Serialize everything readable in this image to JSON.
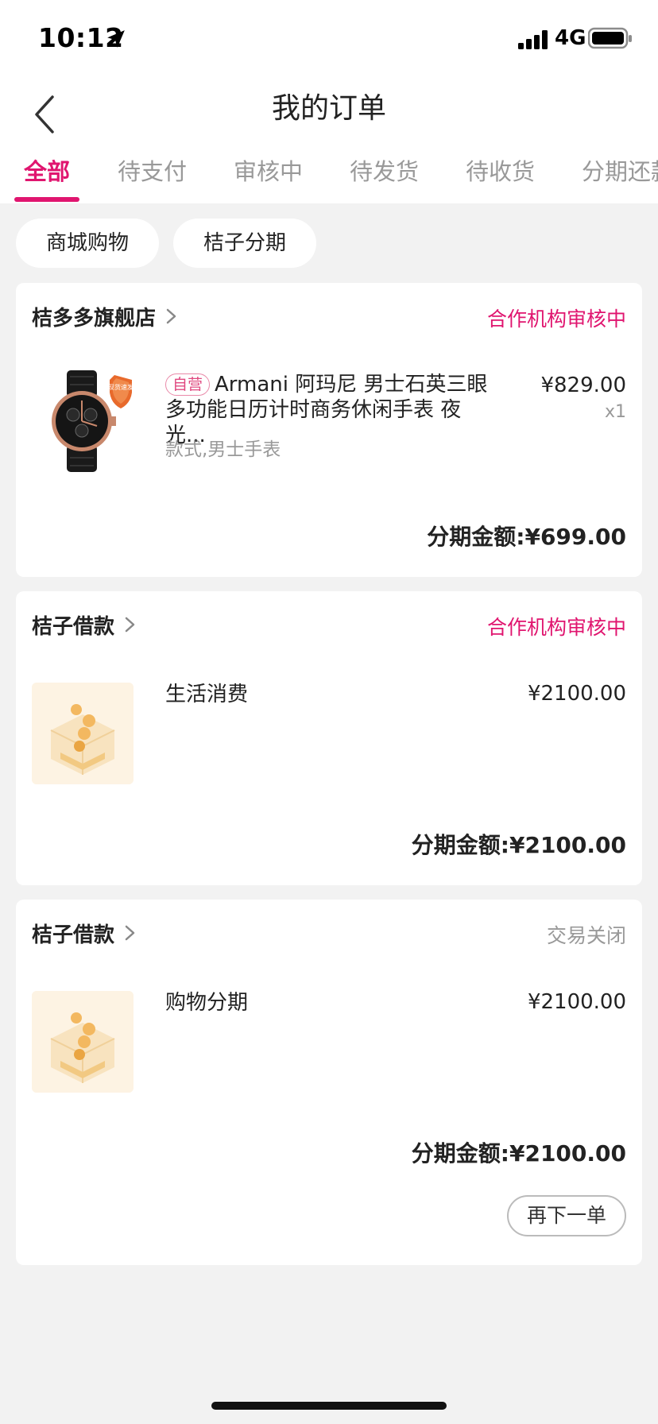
{
  "status_bar": {
    "time": "10:12",
    "network": "4G"
  },
  "header": {
    "title": "我的订单"
  },
  "tabs": [
    {
      "label": "全部",
      "active": true
    },
    {
      "label": "待支付"
    },
    {
      "label": "审核中"
    },
    {
      "label": "待发货"
    },
    {
      "label": "待收货"
    },
    {
      "label": "分期还款"
    }
  ],
  "filters": [
    {
      "label": "商城购物"
    },
    {
      "label": "桔子分期"
    }
  ],
  "orders": [
    {
      "shop": "桔多多旗舰店",
      "status": "合作机构审核中",
      "tag": "自营",
      "title": "Armani 阿玛尼 男士石英三眼多功能日历计时商务休闲手表 夜光...",
      "spec": "款式,男士手表",
      "price": "¥829.00",
      "qty": "x1",
      "installment": "分期金额:¥699.00",
      "badge_text": "现货速发"
    },
    {
      "shop": "桔子借款",
      "status": "合作机构审核中",
      "title": "生活消费",
      "price": "¥2100.00",
      "installment": "分期金额:¥2100.00"
    },
    {
      "shop": "桔子借款",
      "status": "交易关闭",
      "title": "购物分期",
      "price": "¥2100.00",
      "installment": "分期金额:¥2100.00",
      "action": "再下一单"
    }
  ],
  "colors": {
    "accent": "#e0156f",
    "muted": "#999999",
    "background": "#f2f2f2"
  }
}
